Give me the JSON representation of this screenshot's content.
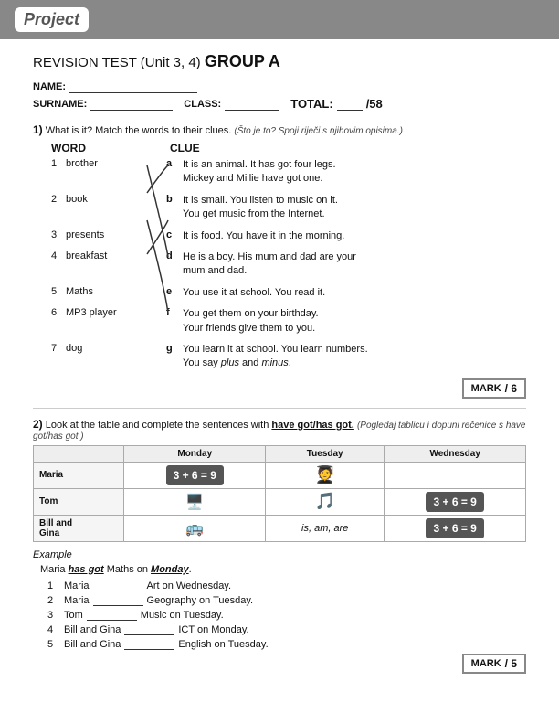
{
  "header": {
    "logo_text": "Project"
  },
  "test_title": {
    "prefix": "REVISION TEST (Unit 3, 4)",
    "group": "GROUP A"
  },
  "fields": {
    "name_label": "NAME:",
    "surname_label": "SURNAME:",
    "class_label": "CLASS:",
    "total_label": "TOTAL:",
    "total_value": "/58"
  },
  "q1": {
    "number": "1)",
    "instruction": "What is it? Match the words to their clues.",
    "instruction_native": "(Što je to? Spoji riječi s njihovim opisima.)",
    "word_header": "WORD",
    "clue_header": "CLUE",
    "items": [
      {
        "num": "1",
        "word": "brother",
        "letter": "a",
        "clue": "It is an animal. It has got four legs. Mickey and Millie have got one."
      },
      {
        "num": "2",
        "word": "book",
        "letter": "b",
        "clue": "It is small. You listen to music on it. You get music from the Internet."
      },
      {
        "num": "3",
        "word": "presents",
        "letter": "c",
        "clue": "It is food. You have it in the morning."
      },
      {
        "num": "4",
        "word": "breakfast",
        "letter": "d",
        "clue": "He is a boy. His mum and dad are your mum and dad."
      },
      {
        "num": "5",
        "word": "Maths",
        "letter": "e",
        "clue": "You use it at school. You read it."
      },
      {
        "num": "6",
        "word": "MP3 player",
        "letter": "f",
        "clue": "You get them on your birthday. Your friends give them to you."
      },
      {
        "num": "7",
        "word": "dog",
        "letter": "g",
        "clue": "You learn it at school. You learn numbers. You say plus and minus."
      }
    ],
    "mark_label": "MARK",
    "mark_value": "/ 6"
  },
  "q2": {
    "number": "2)",
    "instruction_start": "Look at the table and complete the sentences with",
    "instruction_highlight": "have got/has got.",
    "instruction_native": "(Pogledaj tablicu i dopuni rečenice s have got/has got.)",
    "schedule": {
      "headers": [
        "",
        "Monday",
        "Tuesday",
        "Wednesday"
      ],
      "rows": [
        {
          "person": "Maria",
          "monday": "math_eq",
          "tuesday": "person_icon",
          "wednesday": ""
        },
        {
          "person": "Tom",
          "monday": "computer_icon",
          "tuesday": "person_icon2",
          "wednesday": "math_eq2"
        },
        {
          "person": "Bill and Gina",
          "monday": "train_icon",
          "tuesday": "is_am_are",
          "wednesday": "math_eq3"
        }
      ]
    },
    "example_label": "Example",
    "example": "Maria has got Maths on Monday.",
    "sentences": [
      {
        "num": "1",
        "text_before": "Maria",
        "blank_after": true,
        "text_after": "Art on Wednesday."
      },
      {
        "num": "2",
        "text_before": "Maria",
        "blank_after": true,
        "text_after": "Geography on Tuesday."
      },
      {
        "num": "3",
        "text_before": "Tom",
        "blank_after": true,
        "text_after": "Music on Tuesday."
      },
      {
        "num": "4",
        "text_before": "Bill and Gina",
        "blank_after": true,
        "text_after": "ICT on Monday."
      },
      {
        "num": "5",
        "text_before": "Bill and Gina",
        "blank_after": true,
        "text_after": "English on Tuesday."
      }
    ],
    "mark_label": "MARK",
    "mark_value": "/ 5"
  }
}
